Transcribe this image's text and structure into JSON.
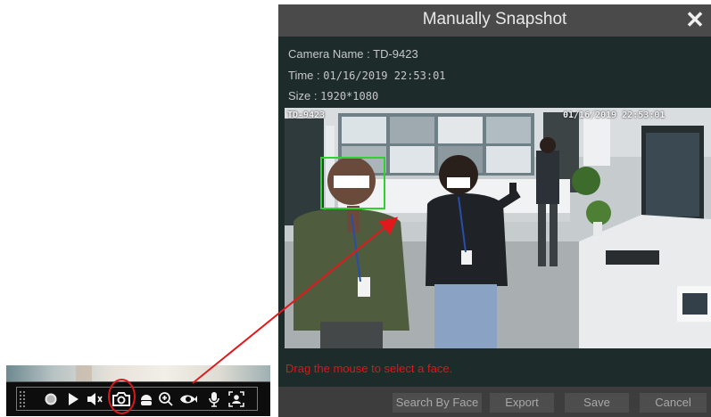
{
  "dialog": {
    "title": "Manually Snapshot",
    "close_glyph": "✕",
    "camera_name_label": "Camera Name :",
    "camera_name_value": "TD-9423",
    "time_label": "Time :",
    "time_value": "01/16/2019 22:53:01",
    "size_label": "Size :",
    "size_value": "1920*1080",
    "preview": {
      "osd_camera": "TD-9423",
      "osd_timestamp": "01/16/2019 22:53:01"
    },
    "hint": "Drag the mouse to select a face.",
    "buttons": {
      "search_by_face": "Search By Face",
      "export": "Export",
      "save": "Save",
      "cancel": "Cancel"
    }
  },
  "toolbar": {
    "icons": [
      "record-icon",
      "play-icon",
      "volume-icon",
      "camera-snapshot-icon",
      "ptz-icon",
      "zoom-in-icon",
      "fisheye-icon",
      "microphone-icon",
      "face-detect-icon"
    ]
  },
  "colors": {
    "highlight": "#d9181b",
    "face_box": "#2fd12f",
    "hint_text": "#e0141b"
  }
}
